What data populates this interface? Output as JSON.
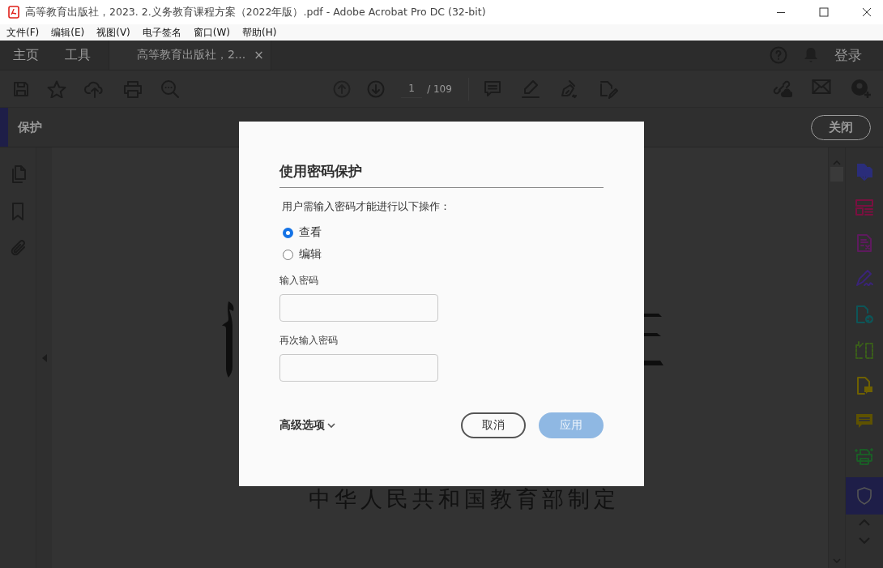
{
  "window": {
    "title": "高等教育出版社，2023. 2.义务教育课程方案（2022年版）.pdf - Adobe Acrobat Pro DC (32-bit)"
  },
  "menu": [
    "文件(F)",
    "编辑(E)",
    "视图(V)",
    "电子签名",
    "窗口(W)",
    "帮助(H)"
  ],
  "tabs": [
    {
      "label": "主页",
      "selected": false
    },
    {
      "label": "工具",
      "selected": false
    },
    {
      "label": "高等教育出版社，2...",
      "selected": true,
      "close": "×"
    }
  ],
  "sign_in": "登录",
  "page_nav": {
    "current": "1",
    "total": "/ 109"
  },
  "tool_header": {
    "title": "保护",
    "close_button": "关闭"
  },
  "document": {
    "footer_text": "中华人民共和国教育部制定"
  },
  "right_tools": [
    {
      "color": "#2a2d7a",
      "selected": false
    },
    {
      "color": "#7a1040",
      "selected": false
    },
    {
      "color": "#5e1a5e",
      "selected": false
    },
    {
      "color": "#3a2478",
      "selected": false
    },
    {
      "color": "#0d5558",
      "selected": false
    },
    {
      "color": "#3a5e1a",
      "selected": false
    },
    {
      "color": "#6e6000",
      "selected": false
    },
    {
      "color": "#5e5200",
      "selected": false
    },
    {
      "color": "#1a5e26",
      "selected": false
    },
    {
      "color": "#4a4a5a",
      "selected": true
    }
  ],
  "dialog": {
    "title": "使用密码保护",
    "description": "用户需输入密码才能进行以下操作：",
    "options": [
      {
        "label": "查看",
        "selected": true
      },
      {
        "label": "编辑",
        "selected": false
      }
    ],
    "fields": [
      {
        "label": "输入密码"
      },
      {
        "label": "再次输入密码"
      }
    ],
    "advanced": "高级选项",
    "buttons": [
      {
        "label": "取消",
        "kind": "secondary",
        "disabled": false
      },
      {
        "label": "应用",
        "kind": "primary",
        "disabled": true
      }
    ]
  }
}
